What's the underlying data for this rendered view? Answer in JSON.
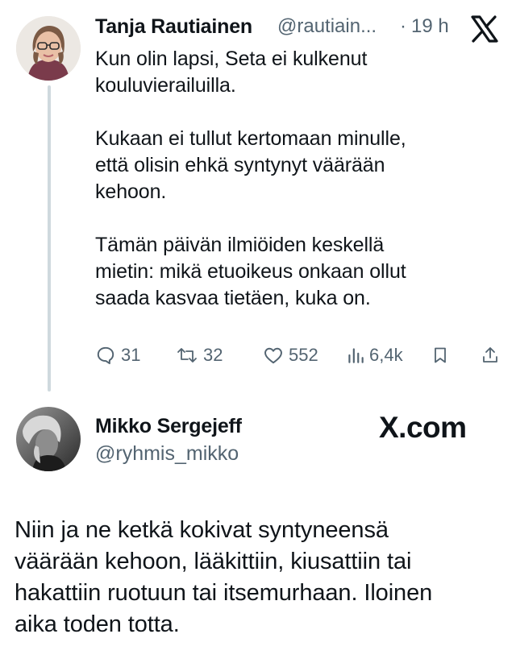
{
  "tweet": {
    "author_name": "Tanja Rautiainen",
    "author_handle": "@rautiain...",
    "sep": "·",
    "time": "19 h",
    "text": "Kun olin lapsi, Seta ei kulkenut\nkouluvierailuilla.\n\nKukaan ei tullut kertomaan minulle,\nettä olisin ehkä syntynyt väärään\nkehoon.\n\nTämän päivän ilmiöiden keskellä\nmietin: mikä etuoikeus onkaan ollut\nsaada kasvaa tietäen, kuka on.",
    "replies": "31",
    "reposts": "32",
    "likes": "552",
    "views": "6,4k"
  },
  "reply": {
    "author_name": "Mikko Sergejeff",
    "author_handle": "@ryhmis_mikko",
    "brand": "X.com",
    "text": "Niin ja ne ketkä kokivat syntyneensä\nväärään kehoon, lääkittiin, kiusattiin tai\nhakattiin ruotuun tai itsemurhaan. Iloinen\naika toden totta."
  },
  "icons": {
    "x_logo": "x-logo-icon",
    "reply": "reply-icon",
    "repost": "repost-icon",
    "like": "heart-icon",
    "views": "views-icon",
    "bookmark": "bookmark-icon",
    "share": "share-icon"
  },
  "colors": {
    "text": "#0f1419",
    "muted": "#536471",
    "thread_line": "#cfd9de"
  }
}
